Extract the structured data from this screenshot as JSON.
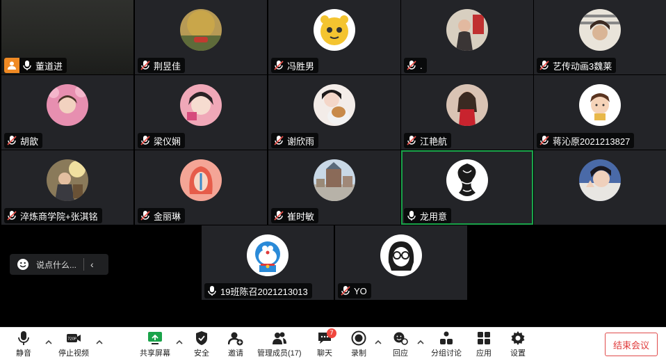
{
  "participants": [
    {
      "name": "董道进",
      "mic": "on",
      "host": true
    },
    {
      "name": "荆昱佳",
      "mic": "muted"
    },
    {
      "name": "冯胜男",
      "mic": "muted"
    },
    {
      "name": ".",
      "mic": "muted"
    },
    {
      "name": "艺传动画3魏莱",
      "mic": "muted"
    },
    {
      "name": "胡歆",
      "mic": "muted"
    },
    {
      "name": "梁仪娴",
      "mic": "muted"
    },
    {
      "name": "谢欣雨",
      "mic": "muted"
    },
    {
      "name": "江艳航",
      "mic": "muted"
    },
    {
      "name": "蒋沁原2021213827",
      "mic": "muted"
    },
    {
      "name": "淬炼商学院+张淇铭",
      "mic": "muted"
    },
    {
      "name": "金丽琳",
      "mic": "muted"
    },
    {
      "name": "崔时敏",
      "mic": "muted"
    },
    {
      "name": "龙用意",
      "mic": "on",
      "speaking": true
    },
    {
      "name": "",
      "mic": "none"
    },
    {
      "name": "19班陈召2021213013",
      "mic": "on"
    },
    {
      "name": "YO",
      "mic": "muted"
    }
  ],
  "chat_input": {
    "placeholder": "说点什么..."
  },
  "toolbar": {
    "mute": "静音",
    "stop_video": "停止视频",
    "share_screen": "共享屏幕",
    "security": "安全",
    "invite": "邀请",
    "manage_members": "管理成员(17)",
    "chat": "聊天",
    "chat_badge": "7",
    "record": "录制",
    "reactions": "回应",
    "breakout": "分组讨论",
    "apps": "应用",
    "settings": "设置",
    "end_meeting": "结束会议",
    "video_quality_tag": "720P"
  },
  "colors": {
    "speaking_border": "#1aa34a",
    "host_badge": "#f08a24",
    "muted_mic": "#e8504a",
    "end_button": "#e03a3a",
    "share_icon": "#1aa34a"
  }
}
